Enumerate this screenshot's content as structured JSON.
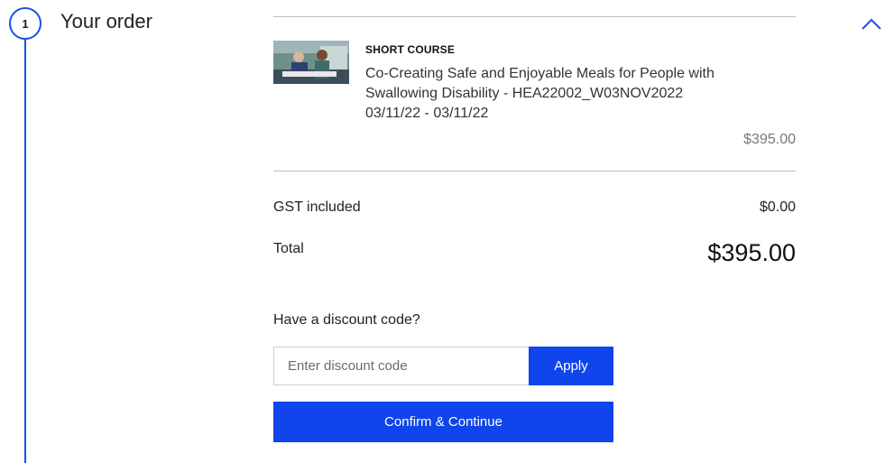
{
  "step": {
    "number": "1",
    "title": "Your order"
  },
  "order_item": {
    "type_badge": "SHORT COURSE",
    "title": "Co-Creating Safe and Enjoyable Meals for People with Swallowing Disability - HEA22002_W03NOV2022",
    "dates": "03/11/22 - 03/11/22",
    "price": "$395.00",
    "thumbnail_icon": "course-photo"
  },
  "summary": {
    "gst_label": "GST included",
    "gst_value": "$0.00",
    "total_label": "Total",
    "total_value": "$395.00"
  },
  "discount": {
    "label": "Have a discount code?",
    "placeholder": "Enter discount code",
    "value": "",
    "apply_label": "Apply"
  },
  "actions": {
    "confirm_label": "Confirm & Continue"
  },
  "colors": {
    "accent": "#0f45ea",
    "step_ring": "#1a4fe6",
    "divider": "#bdbdbd",
    "muted_price": "#777777"
  }
}
